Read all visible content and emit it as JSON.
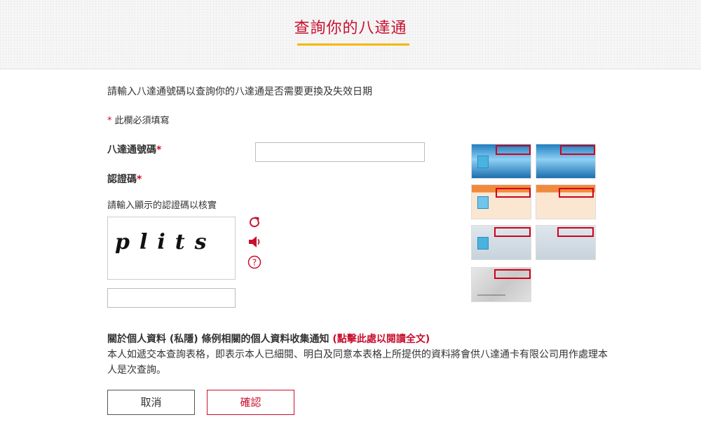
{
  "header": {
    "title": "查詢你的八達通"
  },
  "form": {
    "intro": "請輸入八達通號碼以查詢你的八達通是否需要更換及失效日期",
    "required_marker": "*",
    "required_note": "此欄必須填寫",
    "card_number_label": "八達通號碼",
    "card_number_value": "",
    "captcha_label": "認證碼",
    "captcha_hint": "請輸入顯示的認證碼以核實",
    "captcha_image_text": "plits",
    "captcha_value": ""
  },
  "privacy": {
    "title": "關於個人資料 (私隱) 條例相關的個人資料收集通知 ",
    "link_text": "(點擊此處以閱讀全文)",
    "body": "本人如遞交本查詢表格，即表示本人已細閱、明白及同意本表格上所提供的資料將會供八達通卡有限公司用作處理本人是次查詢。"
  },
  "buttons": {
    "cancel": "取消",
    "confirm": "確認"
  },
  "icons": [
    "refresh-icon",
    "speaker-icon",
    "help-icon"
  ],
  "colors": {
    "accent": "#c8102e",
    "underline": "#f5b800"
  }
}
